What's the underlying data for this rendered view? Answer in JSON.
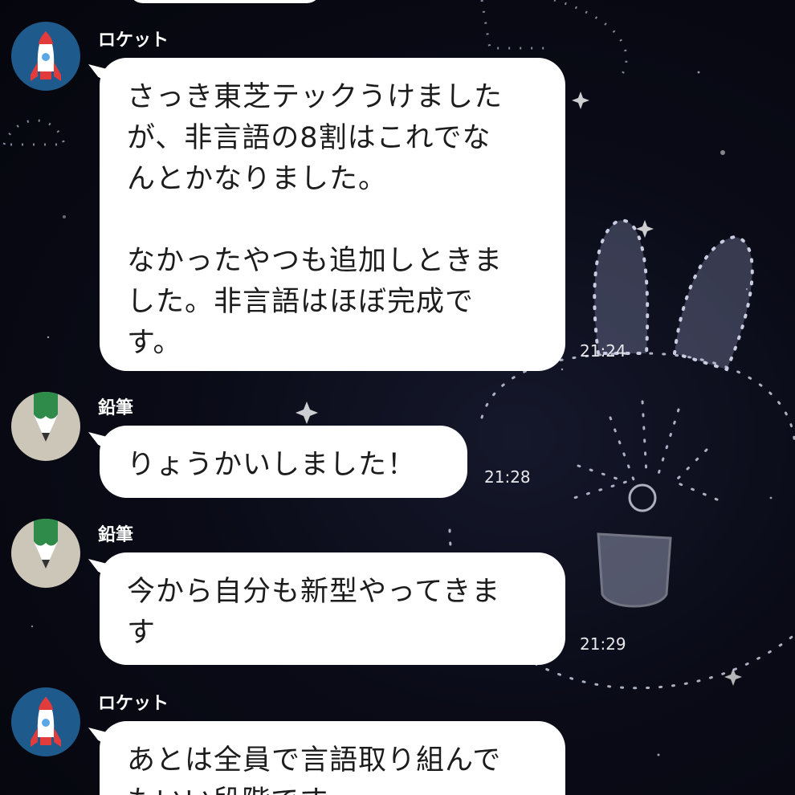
{
  "messages": [
    {
      "sender": "ロケット",
      "avatar": "rocket-avatar",
      "text": "さっき東芝テックうけました\nが、非言語の8割はこれでな\nんとかなりました。\n\nなかったやつも追加しときま\nした。非言語はほぼ完成で\nす。",
      "time": "21:24"
    },
    {
      "sender": "鉛筆",
      "avatar": "pencil-avatar",
      "text": "りょうかいしました！",
      "time": "21:28"
    },
    {
      "sender": "鉛筆",
      "avatar": "pencil-avatar",
      "text": "今から自分も新型やってきま\nす",
      "time": "21:29"
    },
    {
      "sender": "ロケット",
      "avatar": "rocket-avatar",
      "text": "あとは全員で言語取り組んで\nもいい段階です",
      "time": ""
    }
  ],
  "colors": {
    "bubble": "#ffffff",
    "background": "#0a0b17",
    "rocket_avatar_bg": "#1f5a8c",
    "pencil_avatar_bg": "#cbc6b7",
    "pencil_green": "#2e8b4a"
  }
}
